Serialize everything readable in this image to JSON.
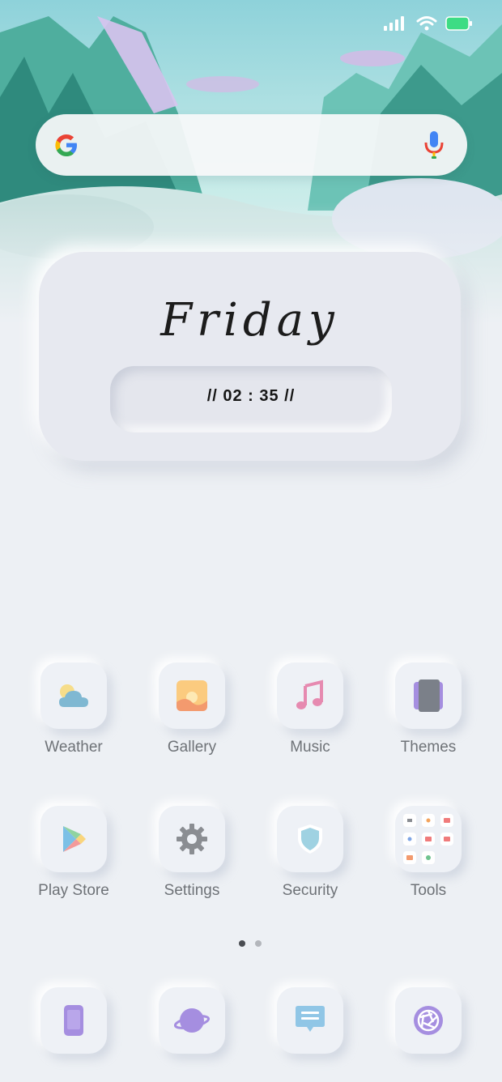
{
  "widget": {
    "day": "Friday",
    "time": "// 02 : 35 //"
  },
  "apps": [
    {
      "label": "Weather",
      "icon": "weather-icon"
    },
    {
      "label": "Gallery",
      "icon": "gallery-icon"
    },
    {
      "label": "Music",
      "icon": "music-icon"
    },
    {
      "label": "Themes",
      "icon": "themes-icon"
    },
    {
      "label": "Play Store",
      "icon": "play-store-icon"
    },
    {
      "label": "Settings",
      "icon": "settings-icon"
    },
    {
      "label": "Security",
      "icon": "security-icon"
    },
    {
      "label": "Tools",
      "icon": "tools-folder-icon"
    }
  ],
  "dock": [
    {
      "icon": "phone-icon"
    },
    {
      "icon": "browser-planet-icon"
    },
    {
      "icon": "messages-icon"
    },
    {
      "icon": "camera-icon"
    }
  ],
  "pager": {
    "pages": 2,
    "active": 1
  },
  "colors": {
    "battery": "#3ddc84",
    "background": "#edf0f4",
    "accent_purple": "#a58ee0"
  }
}
